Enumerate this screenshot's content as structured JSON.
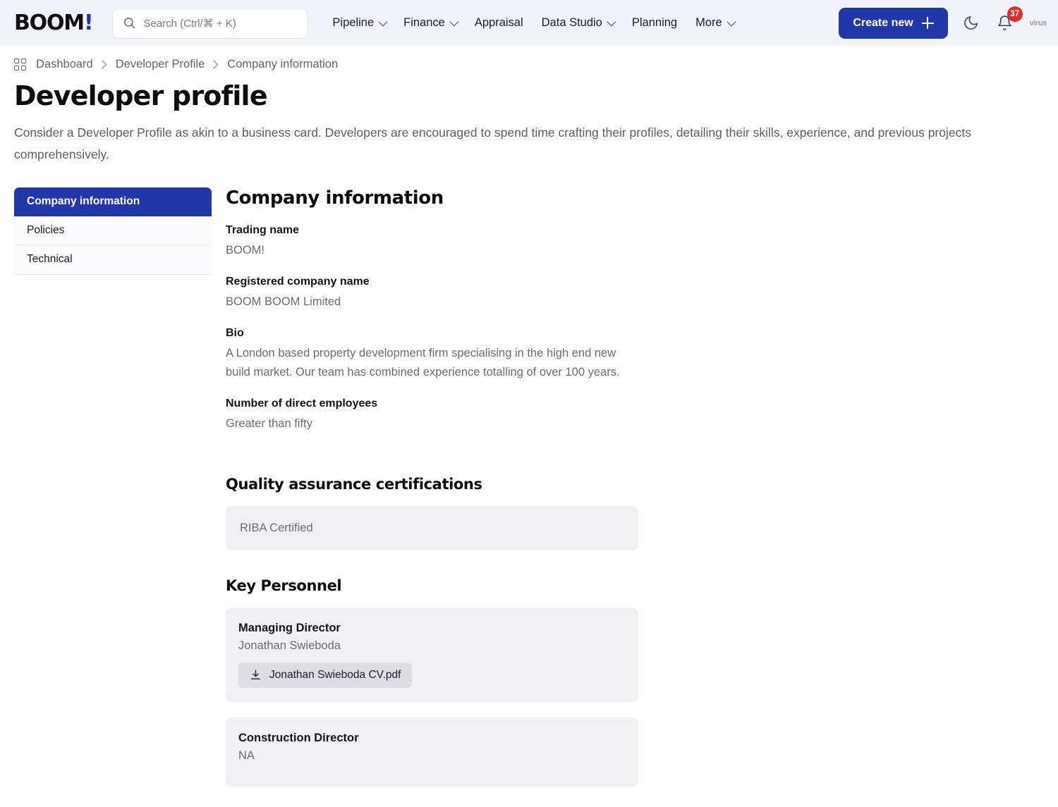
{
  "header": {
    "brand_text": "BOOM",
    "brand_accent": "!",
    "search": {
      "placeholder": "Search (Ctrl/⌘ + K)",
      "value": "",
      "icon": "search-icon"
    },
    "nav": [
      {
        "label": "Pipeline",
        "has_caret": true
      },
      {
        "label": "Finance",
        "has_caret": true
      },
      {
        "label": "Appraisal",
        "has_caret": false
      },
      {
        "label": "Data Studio",
        "has_caret": true
      },
      {
        "label": "Planning",
        "has_caret": false
      },
      {
        "label": "More",
        "has_caret": true
      }
    ],
    "create_button": {
      "label": "Create new",
      "icon": "plus-icon"
    },
    "theme_toggle_icon": "moon-icon",
    "notifications": {
      "icon": "bell-icon",
      "count": "37",
      "badge_color": "#e02b2b"
    },
    "watermark": "virus",
    "accent_color": "#2338a8",
    "background": "#f2f2fa"
  },
  "breadcrumb": {
    "home_icon": "dashboard-grid-icon",
    "separator": "›",
    "items": [
      "Dashboard",
      "Developer Profile",
      "Company information"
    ]
  },
  "page": {
    "title": "Developer profile",
    "subtitle": "Consider a Developer Profile as akin to a business card. Developers are encouraged to spend time crafting their profiles, detailing their skills, experience, and previous projects comprehensively."
  },
  "side_tabs": {
    "items": [
      {
        "label": "Company information",
        "active": true
      },
      {
        "label": "Policies",
        "active": false
      },
      {
        "label": "Technical",
        "active": false
      }
    ]
  },
  "main": {
    "section_title": "Company information",
    "fields": [
      {
        "label": "Trading name",
        "value": "BOOM!"
      },
      {
        "label": "Registered company name",
        "value": "BOOM BOOM Limited"
      },
      {
        "label": "Bio",
        "value": "A London based property development firm specialising in the high end new build market. Our team has combined experience totalling of over 100 years."
      },
      {
        "label": "Number of direct employees",
        "value": "Greater than fifty"
      }
    ],
    "quality": {
      "title": "Quality assurance certifications",
      "value": "RIBA Certified"
    },
    "key_personnel": {
      "title": "Key Personnel",
      "people": [
        {
          "role": "Managing Director",
          "name": "Jonathan Swieboda",
          "file": {
            "label": "Jonathan Swieboda CV.pdf",
            "icon": "download-icon"
          }
        },
        {
          "role": "Construction Director",
          "name": "NA",
          "file": null
        }
      ]
    }
  }
}
